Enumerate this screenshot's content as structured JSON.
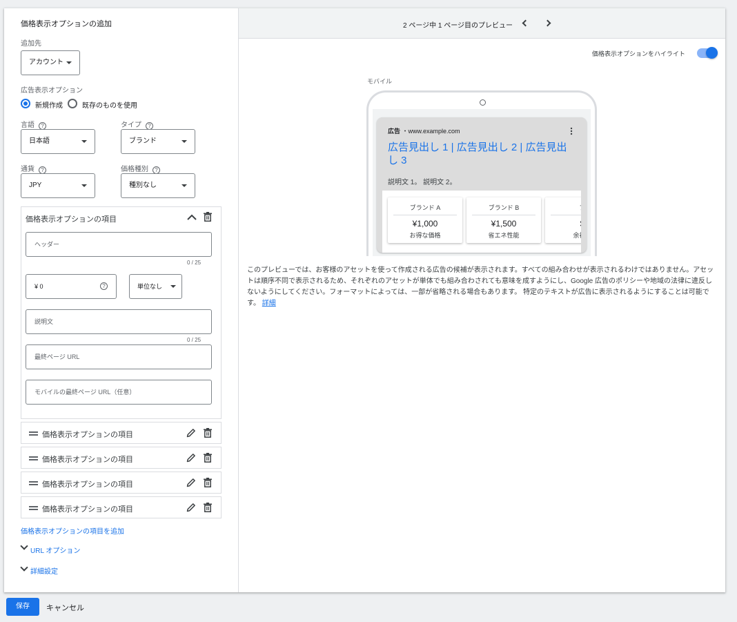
{
  "dialog": {
    "title": "価格表示オプションの追加",
    "destination_label": "追加先",
    "destination_value": "アカウント",
    "option_label": "広告表示オプション",
    "radio_new": "新規作成",
    "radio_existing": "既存のものを使用",
    "radio_selected": "新規作成",
    "language_label": "言語",
    "language_value": "日本語",
    "type_label": "タイプ",
    "type_value": "ブランド",
    "currency_label": "通貨",
    "currency_value": "JPY",
    "price_type_label": "価格種別",
    "price_type_value": "種別なし"
  },
  "item_editor": {
    "title": "価格表示オプションの項目",
    "header_placeholder": "ヘッダー",
    "header_counter": "0 / 25",
    "price_value": "¥ 0",
    "unit_value": "単位なし",
    "description_placeholder": "説明文",
    "description_counter": "0 / 25",
    "final_url_placeholder": "最終ページ URL",
    "mobile_url_placeholder": "モバイルの最終ページ URL（任意）"
  },
  "collapsed_items": [
    {
      "label": "価格表示オプションの項目"
    },
    {
      "label": "価格表示オプションの項目"
    },
    {
      "label": "価格表示オプションの項目"
    },
    {
      "label": "価格表示オプションの項目"
    }
  ],
  "links": {
    "add_item": "価格表示オプションの項目を追加",
    "url_options": "URL オプション",
    "advanced": "詳細設定"
  },
  "preview": {
    "page_indicator": "2 ページ中 1 ページ目のプレビュー",
    "highlight_label": "価格表示オプションをハイライト",
    "highlight_on": true,
    "device_label": "モバイル",
    "ad_badge": "広告",
    "ad_url": "・www.example.com",
    "headline": "広告見出し 1 | 広告見出し 2 | 広告見出し 3",
    "description": "説明文 1。 説明文 2。",
    "price_cards": [
      {
        "header": "ブランド A",
        "price": "¥1,000",
        "desc": "お得な価格"
      },
      {
        "header": "ブランド B",
        "price": "¥1,500",
        "desc": "省エネ性能"
      },
      {
        "header": "ブ",
        "price": "$",
        "desc": "余裕の"
      }
    ],
    "notice": "このプレビューでは、お客様のアセットを使って作成される広告の候補が表示されます。すべての組み合わせが表示されるわけではありません。アセットは順序不同で表示されるため、それぞれのアセットが単体でも組み合わされても意味を成すようにし、Google 広告のポリシーや地域の法律に違反しないようにしてください。フォーマットによっては、一部が省略される場合もあります。 特定のテキストが広告に表示されるようにすることは可能です。",
    "notice_link": "詳細"
  },
  "footer": {
    "save": "保存",
    "cancel": "キャンセル"
  },
  "colors": {
    "accent": "#1a73e8",
    "toggle_track": "#8ab4f8",
    "border": "#dadce0"
  }
}
